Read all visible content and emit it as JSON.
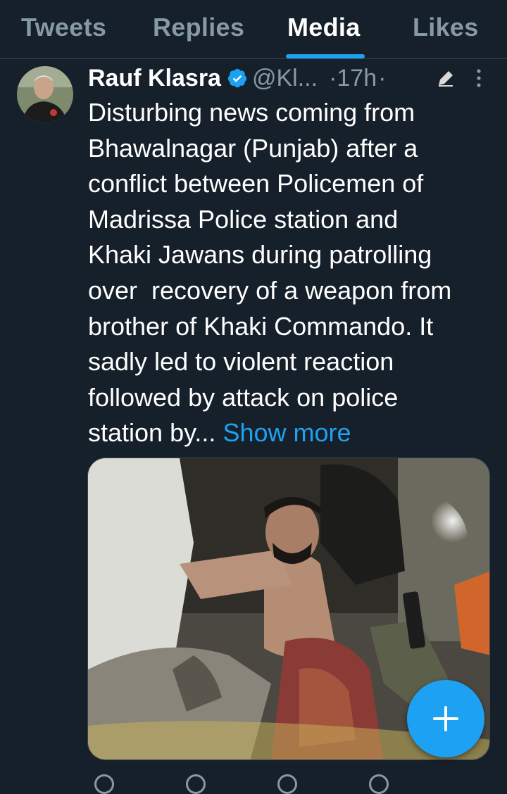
{
  "tabs": [
    {
      "label": "Tweets",
      "active": false
    },
    {
      "label": "Replies",
      "active": false
    },
    {
      "label": "Media",
      "active": true
    },
    {
      "label": "Likes",
      "active": false
    }
  ],
  "tweet": {
    "author_name": "Rauf Klasra",
    "verified": true,
    "handle": "@Kl...",
    "separator": "·",
    "time": "17h",
    "separator2": "·",
    "text_lines": [
      "Disturbing news coming from",
      "Bhawalnagar (Punjab) after a",
      "conflict between Policemen of",
      "Madrissa Police station and",
      "Khaki Jawans during patrolling",
      "over  recovery of a weapon from",
      "brother of Khaki Commando. It",
      "sadly led to violent reaction",
      "followed by attack on police",
      "station by... "
    ],
    "show_more": "Show more"
  },
  "icons": {
    "verified": "verified-badge-icon",
    "edit": "pencil-edit-icon",
    "more": "more-vertical-icon",
    "fab": "plus-icon"
  },
  "colors": {
    "background": "#15202b",
    "accent": "#1da1f2",
    "secondary_text": "#8899a6",
    "divider": "#38444d"
  }
}
